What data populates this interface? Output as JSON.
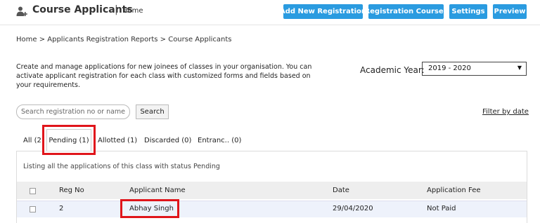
{
  "header": {
    "title": "Course Applicants",
    "separator": "|",
    "home": "Home",
    "buttons": {
      "add_new": "Add New Registration",
      "registration_courses": "Registration Courses",
      "settings": "Settings",
      "preview": "Preview"
    },
    "button_color": "#2a9be0"
  },
  "breadcrumb": "Home > Applicants Registration Reports > Course Applicants",
  "description": "Create and manage applications for new joinees of classes in your organisation. You can activate applicant registration for each class with customized forms and fields based on your requirements.",
  "academic_year": {
    "label": "Academic Year:",
    "value": "2019 - 2020"
  },
  "search": {
    "placeholder": "Search registration no or name",
    "button": "Search",
    "filter_link": "Filter by date"
  },
  "tabs": [
    {
      "label": "All (2"
    },
    {
      "label": "Pending (1)"
    },
    {
      "label": "Allotted (1)"
    },
    {
      "label": "Discarded (0)"
    },
    {
      "label": "Entranc.. (0)"
    }
  ],
  "panel_note": "Listing all the applications of this class with status Pending",
  "table": {
    "columns": [
      "Reg No",
      "Applicant Name",
      "Date",
      "Application Fee"
    ],
    "rows": [
      {
        "reg_no": "2",
        "name": "Abhay Singh",
        "date": "29/04/2020",
        "fee": "Not Paid"
      }
    ]
  },
  "highlight_color": "#e0151b"
}
